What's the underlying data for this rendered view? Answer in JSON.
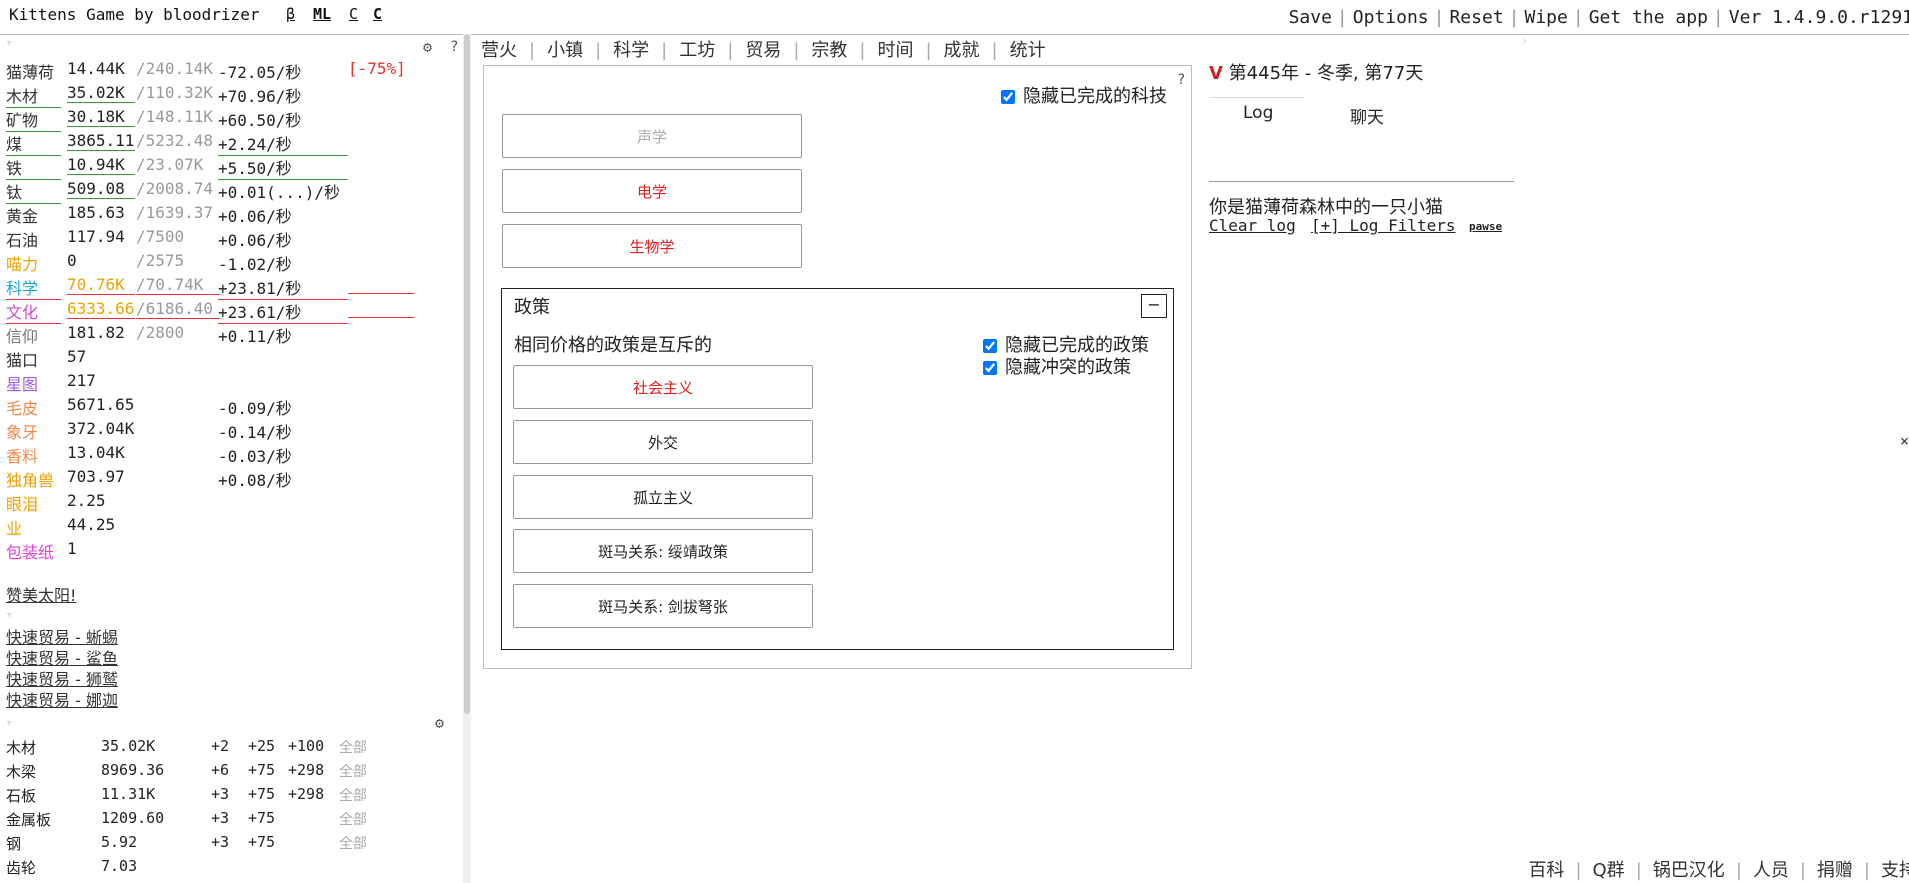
{
  "header": {
    "title": "Kittens Game by bloodrizer",
    "links": [
      "β",
      "ML",
      "C",
      "C"
    ],
    "menu": [
      "Save",
      "Options",
      "Reset",
      "Wipe",
      "Get the app",
      "Ver 1.4.9.0.r1291"
    ]
  },
  "resources": [
    {
      "name": "猫薄荷",
      "value": "14.44K",
      "max": "/240.14K",
      "rate": "-72.05/秒",
      "cap": "[-75%]",
      "color": "#333",
      "valcolor": "#222"
    },
    {
      "name": "木材",
      "value": "35.02K",
      "max": "/110.32K",
      "rate": "+70.96/秒",
      "cap": "",
      "color": "#333",
      "valcolor": "#222"
    },
    {
      "name": "矿物",
      "value": "30.18K",
      "max": "/148.11K",
      "rate": "+60.50/秒",
      "cap": "",
      "color": "#333",
      "valcolor": "#222"
    },
    {
      "name": "煤",
      "value": "3865.11",
      "max": "/5232.48",
      "rate": "+2.24/秒",
      "cap": "",
      "color": "#333",
      "valcolor": "#222"
    },
    {
      "name": "铁",
      "value": "10.94K",
      "max": "/23.07K",
      "rate": "+5.50/秒",
      "cap": "",
      "color": "#333",
      "valcolor": "#222"
    },
    {
      "name": "钛",
      "value": "509.08",
      "max": "/2008.74",
      "rate": "+0.01(...)/秒",
      "cap": "",
      "color": "#333",
      "valcolor": "#222"
    },
    {
      "name": "黄金",
      "value": "185.63",
      "max": "/1639.37",
      "rate": "+0.06/秒",
      "cap": "",
      "color": "#333",
      "valcolor": "#222"
    },
    {
      "name": "石油",
      "value": "117.94",
      "max": "/7500",
      "rate": "+0.06/秒",
      "cap": "",
      "color": "#333",
      "valcolor": "#222"
    },
    {
      "name": "喵力",
      "value": "0",
      "max": "/2575",
      "rate": "-1.02/秒",
      "cap": "",
      "color": "#e9a400",
      "valcolor": "#222"
    },
    {
      "name": "科学",
      "value": "70.76K",
      "max": "/70.74K",
      "rate": "+23.81/秒",
      "cap": "",
      "color": "#1aa7d8",
      "valcolor": "#e9a400"
    },
    {
      "name": "文化",
      "value": "6333.66",
      "max": "/6186.40",
      "rate": "+23.61/秒",
      "cap": "",
      "color": "#d24bd2",
      "valcolor": "#e9a400"
    },
    {
      "name": "信仰",
      "value": "181.82",
      "max": "/2800",
      "rate": "+0.11/秒",
      "cap": "",
      "color": "#777",
      "valcolor": "#222"
    },
    {
      "name": "猫口",
      "value": "57",
      "max": "",
      "rate": "",
      "cap": "",
      "color": "#333",
      "valcolor": "#222"
    },
    {
      "name": "星图",
      "value": "217",
      "max": "",
      "rate": "",
      "cap": "",
      "color": "#a25be0",
      "valcolor": "#222"
    },
    {
      "name": "毛皮",
      "value": "5671.65",
      "max": "",
      "rate": "-0.09/秒",
      "cap": "",
      "color": "#f0884a",
      "valcolor": "#222"
    },
    {
      "name": "象牙",
      "value": "372.04K",
      "max": "",
      "rate": "-0.14/秒",
      "cap": "",
      "color": "#f0884a",
      "valcolor": "#222"
    },
    {
      "name": "香料",
      "value": "13.04K",
      "max": "",
      "rate": "-0.03/秒",
      "cap": "",
      "color": "#f0884a",
      "valcolor": "#222"
    },
    {
      "name": "独角兽",
      "value": "703.97",
      "max": "",
      "rate": "+0.08/秒",
      "cap": "",
      "color": "#f0a000",
      "valcolor": "#222"
    },
    {
      "name": "眼泪",
      "value": "2.25",
      "max": "",
      "rate": "",
      "cap": "",
      "color": "#f0a000",
      "valcolor": "#222"
    },
    {
      "name": "业",
      "value": "44.25",
      "max": "",
      "rate": "",
      "cap": "",
      "color": "#f0a000",
      "valcolor": "#222"
    },
    {
      "name": "包装纸",
      "value": "1",
      "max": "",
      "rate": "",
      "cap": "",
      "color": "#e040e0",
      "valcolor": "#222"
    }
  ],
  "praise_sun": "赞美太阳!",
  "quick_trades": [
    "快速贸易 - 蜥蜴",
    "快速贸易 - 鲨鱼",
    "快速贸易 - 狮鹫",
    "快速贸易 - 娜迦"
  ],
  "crafts": [
    {
      "name": "木材",
      "value": "35.02K",
      "b1": "+2",
      "b2": "+25",
      "b3": "+100",
      "all": "全部"
    },
    {
      "name": "木梁",
      "value": "8969.36",
      "b1": "+6",
      "b2": "+75",
      "b3": "+298",
      "all": "全部"
    },
    {
      "name": "石板",
      "value": "11.31K",
      "b1": "+3",
      "b2": "+75",
      "b3": "+298",
      "all": "全部"
    },
    {
      "name": "金属板",
      "value": "1209.60",
      "b1": "+3",
      "b2": "+75",
      "b3": "",
      "all": "全部"
    },
    {
      "name": "钢",
      "value": "5.92",
      "b1": "+3",
      "b2": "+75",
      "b3": "",
      "all": "全部"
    },
    {
      "name": "齿轮",
      "value": "7.03",
      "b1": "",
      "b2": "",
      "b3": "",
      "all": ""
    }
  ],
  "tabs": [
    "营火",
    "小镇",
    "科学",
    "工坊",
    "贸易",
    "宗教",
    "时间",
    "成就",
    "统计"
  ],
  "science": {
    "hide_completed_tech": "隐藏已完成的科技",
    "techs": [
      {
        "label": "声学",
        "color": "#aaa"
      },
      {
        "label": "电学",
        "color": "#e02020"
      },
      {
        "label": "生物学",
        "color": "#e02020"
      }
    ],
    "policy": {
      "title": "政策",
      "collapse": "−",
      "note": "相同价格的政策是互斥的",
      "hide_completed": "隐藏已完成的政策",
      "hide_conflict": "隐藏冲突的政策",
      "buttons": [
        {
          "label": "社会主义",
          "color": "#e02020"
        },
        {
          "label": "外交",
          "color": "#222"
        },
        {
          "label": "孤立主义",
          "color": "#222"
        },
        {
          "label": "斑马关系: 绥靖政策",
          "color": "#222"
        },
        {
          "label": "斑马关系: 剑拔弩张",
          "color": "#222"
        }
      ]
    }
  },
  "log": {
    "v_mark": "V",
    "date": "第445年 - 冬季, 第77天",
    "tabs": [
      "Log",
      "聊天"
    ],
    "message": "你是猫薄荷森林中的一只小猫",
    "clear": "Clear log",
    "filters": "[+] Log Filters",
    "pause": "pawse"
  },
  "footer": [
    "百科",
    "Q群",
    "锅巴汉化",
    "人员",
    "捐赠",
    "支持"
  ],
  "qmark": "?",
  "gear": "⚙"
}
